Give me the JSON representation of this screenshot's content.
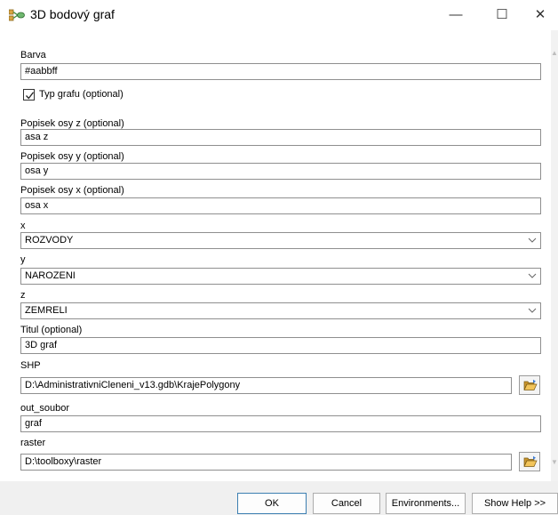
{
  "window": {
    "title": "3D bodový graf",
    "minimize_glyph": "—",
    "maximize_glyph": "☐",
    "close_glyph": "✕"
  },
  "form": {
    "barva": {
      "label": "Barva",
      "value": "#aabbff"
    },
    "typ_grafu": {
      "label": "Typ grafu (optional)",
      "checked": true
    },
    "popisek_z": {
      "label": "Popisek osy z (optional)",
      "value": "asa z"
    },
    "popisek_y": {
      "label": "Popisek osy y (optional)",
      "value": "osa y"
    },
    "popisek_x": {
      "label": "Popisek osy x (optional)",
      "value": "osa x"
    },
    "x": {
      "label": "x",
      "value": "ROZVODY"
    },
    "y": {
      "label": "y",
      "value": "NAROZENI"
    },
    "z": {
      "label": "z",
      "value": "ZEMRELI"
    },
    "titul": {
      "label": "Titul (optional)",
      "value": "3D graf"
    },
    "shp": {
      "label": "SHP",
      "value": "D:\\AdministrativniCleneni_v13.gdb\\KrajePolygony"
    },
    "out_soubor": {
      "label": "out_soubor",
      "value": "graf"
    },
    "raster": {
      "label": "raster",
      "value": "D:\\toolboxy\\raster"
    }
  },
  "buttons": {
    "ok": "OK",
    "cancel": "Cancel",
    "environments": "Environments...",
    "show_help": "Show Help >>"
  },
  "icons": {
    "app": "toolbox-model-icon",
    "browse": "open-folder-icon",
    "dropdown": "chevron-down-icon"
  },
  "colors": {
    "ok_border": "#3c7fb1",
    "folder_yellow": "#e8b84a"
  }
}
